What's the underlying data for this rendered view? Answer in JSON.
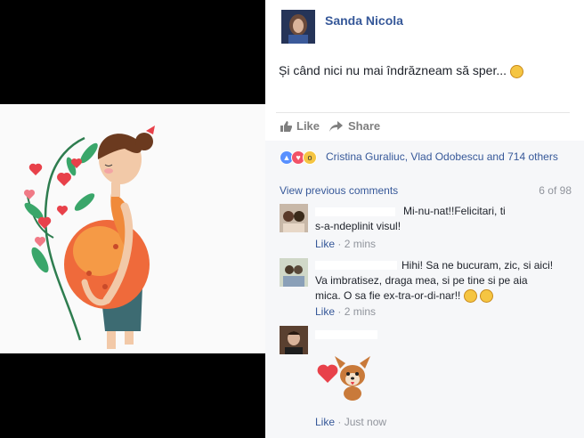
{
  "post": {
    "author": "Sanda Nicola",
    "text": "Și când nici nu mai îndrăzneam să sper...",
    "actions": {
      "like": "Like",
      "share": "Share"
    },
    "reactions": {
      "icons": [
        "like-reaction-icon",
        "love-reaction-icon",
        "wow-reaction-icon"
      ],
      "names": "Cristina Guraliuc, Vlad Odobescu and 714 others"
    }
  },
  "comments_bar": {
    "view_previous": "View previous comments",
    "count": "6 of 98"
  },
  "comments": [
    {
      "text_lines": [
        "Mi-nu-nat!!Felicitari, ti",
        "s-a-ndeplinit visul!"
      ],
      "like": "Like",
      "time": "2 mins"
    },
    {
      "text_lines": [
        "Hihi! Sa ne bucuram, zic, si aici!",
        "Va imbratisez, draga mea, si pe tine si pe aia",
        "mica. O sa fie ex-tra-or-di-nar!!"
      ],
      "like": "Like",
      "time": "2 mins"
    },
    {
      "sticker": "puppy-heart-sticker",
      "like": "Like",
      "time": "Just now"
    }
  ],
  "colors": {
    "link": "#365899",
    "meta": "#90949c",
    "comment_bg": "#f6f7f9"
  }
}
